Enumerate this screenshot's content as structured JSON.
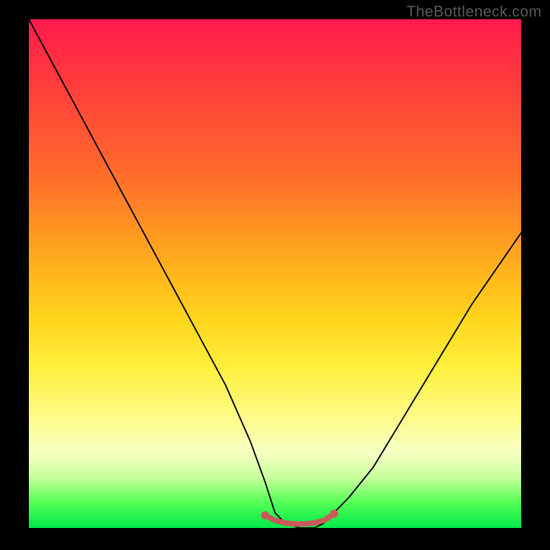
{
  "watermark": "TheBottleneck.com",
  "chart_data": {
    "type": "line",
    "title": "",
    "xlabel": "",
    "ylabel": "",
    "xlim": [
      0,
      100
    ],
    "ylim": [
      0,
      100
    ],
    "grid": false,
    "legend": false,
    "background_gradient": {
      "top": "#ff1a4d",
      "mid1": "#ffa31f",
      "mid2": "#ffef3a",
      "bottom": "#00e84a"
    },
    "series": [
      {
        "name": "bottleneck-curve",
        "stroke": "#000000",
        "x": [
          0,
          5,
          10,
          15,
          20,
          25,
          30,
          35,
          40,
          45,
          48,
          50,
          52,
          55,
          58,
          60,
          62,
          65,
          70,
          75,
          80,
          85,
          90,
          95,
          100
        ],
        "y": [
          100,
          91,
          82,
          73,
          64,
          55,
          46,
          37,
          28,
          17,
          9,
          3,
          1,
          0,
          0,
          1,
          3,
          6,
          12,
          20,
          28,
          36,
          44,
          51,
          58
        ]
      },
      {
        "name": "valley-marker",
        "stroke": "#c85a5a",
        "x": [
          48,
          50,
          52,
          54,
          56,
          58,
          60,
          62
        ],
        "y": [
          2.5,
          1.5,
          1.0,
          0.8,
          0.8,
          1.0,
          1.5,
          2.8
        ]
      }
    ],
    "annotations": []
  }
}
